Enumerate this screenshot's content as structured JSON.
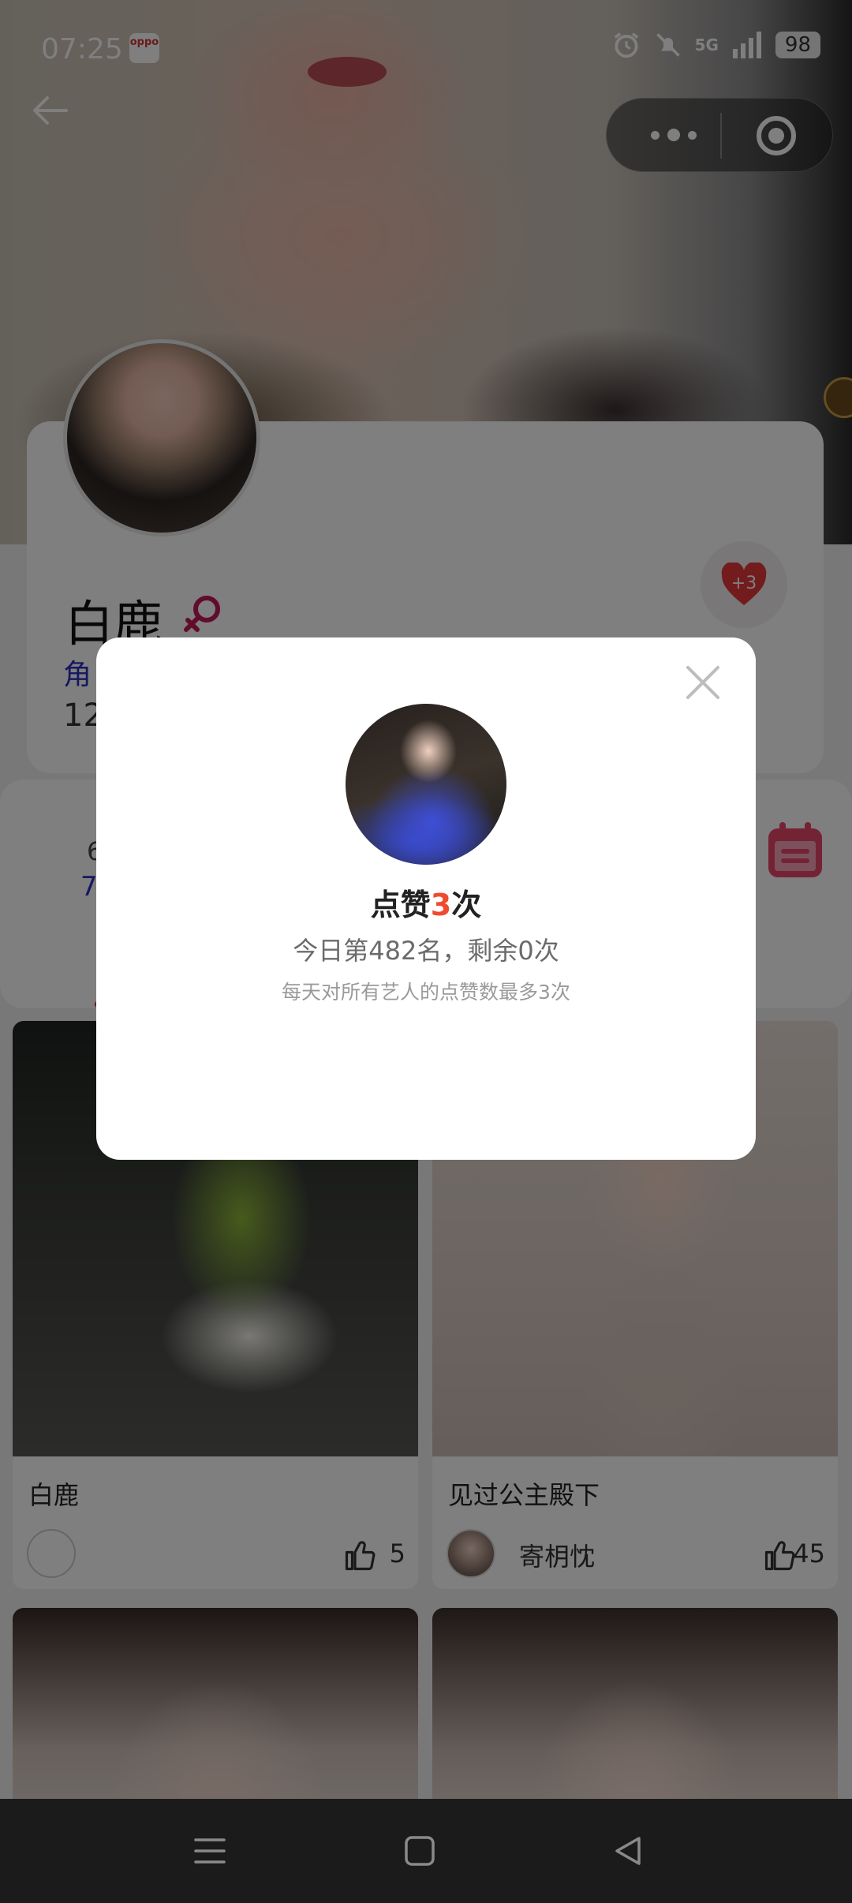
{
  "status_bar": {
    "time": "07:25",
    "app_badge": "oppo",
    "network": "5G",
    "battery": "98"
  },
  "profile": {
    "name": "白鹿",
    "role_partial": "角",
    "number_partial": "12",
    "heart_badge": "+3"
  },
  "stats": {
    "top_partial": "6",
    "bottom_partial": "7"
  },
  "posts": [
    {
      "title": "白鹿",
      "user_name": "",
      "likes": "5"
    },
    {
      "title": "见过公主殿下",
      "user_name": "寄枂忱",
      "likes": "45"
    }
  ],
  "dialog": {
    "title_prefix": "点赞",
    "title_count": "3",
    "title_suffix": "次",
    "subtitle": "今日第482名，剩余0次",
    "note": "每天对所有艺人的点赞数最多3次"
  },
  "colors": {
    "accent": "#f04a2f",
    "link_blue": "#2c2ec4",
    "heart_red": "#e4393c",
    "calendar_pink": "#e8476b"
  }
}
